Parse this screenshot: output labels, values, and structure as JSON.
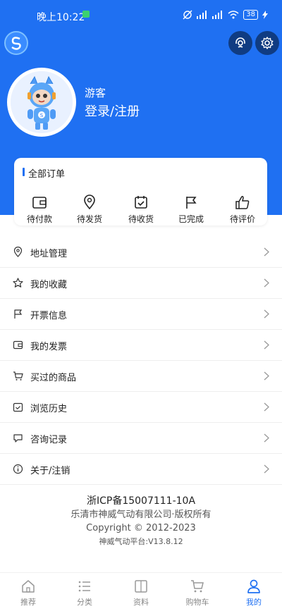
{
  "status_bar": {
    "time": "晚上10:22",
    "battery": "38"
  },
  "header": {
    "role": "游客",
    "login": "登录/注册"
  },
  "orders": {
    "title": "全部订单",
    "items": [
      {
        "label": "待付款",
        "icon": "wallet-icon"
      },
      {
        "label": "待发货",
        "icon": "location-pin-icon"
      },
      {
        "label": "待收货",
        "icon": "calendar-check-icon"
      },
      {
        "label": "已完成",
        "icon": "flag-icon"
      },
      {
        "label": "待评价",
        "icon": "thumbs-up-icon"
      }
    ]
  },
  "menu": [
    {
      "label": "地址管理",
      "icon": "location-pin-icon"
    },
    {
      "label": "我的收藏",
      "icon": "star-icon"
    },
    {
      "label": "开票信息",
      "icon": "flag-icon"
    },
    {
      "label": "我的发票",
      "icon": "wallet-icon"
    },
    {
      "label": "买过的商品",
      "icon": "cart-icon"
    },
    {
      "label": "浏览历史",
      "icon": "calendar-check-icon"
    },
    {
      "label": "咨询记录",
      "icon": "chat-icon"
    },
    {
      "label": "关于/注销",
      "icon": "info-icon"
    }
  ],
  "footer": {
    "icp": "浙ICP备15007111-10A",
    "company": "乐清市神威气动有限公司·版权所有",
    "copyright": "Copyright © 2012-2023",
    "platform": "神威气动平台:V13.8.12"
  },
  "tabbar": [
    {
      "label": "推荐",
      "icon": "home-icon"
    },
    {
      "label": "分类",
      "icon": "list-icon"
    },
    {
      "label": "资料",
      "icon": "book-icon"
    },
    {
      "label": "购物车",
      "icon": "cart-icon"
    },
    {
      "label": "我的",
      "icon": "user-icon",
      "active": true
    }
  ],
  "colors": {
    "primary": "#1f70f2",
    "header_button": "#103c82"
  }
}
